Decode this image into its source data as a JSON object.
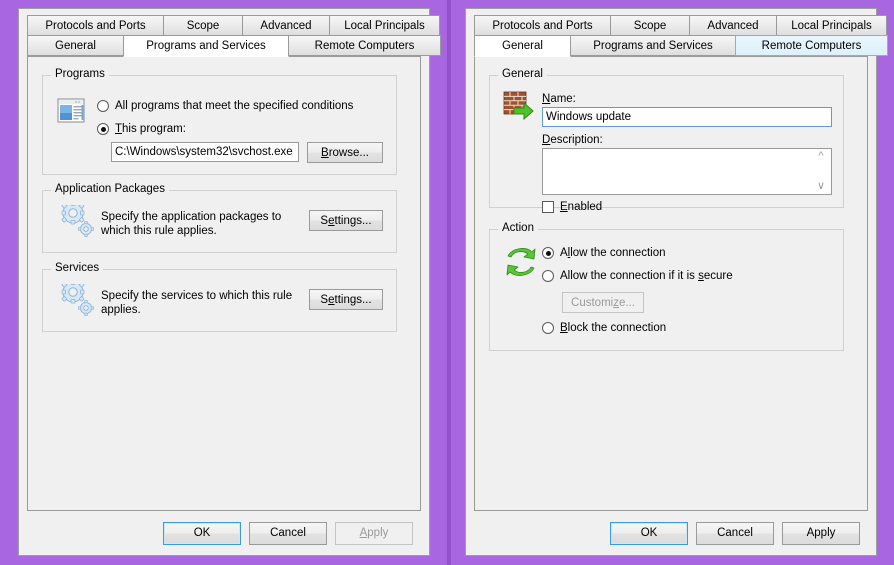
{
  "theme": {
    "desktop_bg": "#a866e0",
    "divider": "#9350cc",
    "dialog_bg": "#f0f0f0",
    "accent_focus": "#5a9fd4",
    "tab_hover": "#ddf1fb"
  },
  "left_dialog": {
    "tabs_row1": [
      {
        "label": "Protocols and Ports",
        "state": "normal"
      },
      {
        "label": "Scope",
        "state": "normal"
      },
      {
        "label": "Advanced",
        "state": "normal"
      },
      {
        "label": "Local Principals",
        "state": "normal"
      }
    ],
    "tabs_row2": [
      {
        "label": "General",
        "state": "normal"
      },
      {
        "label": "Programs and Services",
        "state": "active"
      },
      {
        "label": "Remote Computers",
        "state": "normal"
      }
    ],
    "programs_group": {
      "legend": "Programs",
      "icon": "application-window-icon",
      "radio_all": {
        "label": "All programs that meet the specified conditions",
        "checked": false
      },
      "radio_this": {
        "label": "This program:",
        "checked": true
      },
      "program_path": "C:\\Windows\\system32\\svchost.exe",
      "browse_button": "Browse..."
    },
    "app_packages_group": {
      "legend": "Application Packages",
      "icon": "gears-icon",
      "description": "Specify the application packages to which this rule applies.",
      "settings_button": "Settings..."
    },
    "services_group": {
      "legend": "Services",
      "icon": "gears-icon",
      "description": "Specify the services to which this rule applies.",
      "settings_button": "Settings..."
    },
    "buttons": {
      "ok": "OK",
      "cancel": "Cancel",
      "apply": "Apply",
      "apply_enabled": false
    }
  },
  "right_dialog": {
    "tabs_row1": [
      {
        "label": "Protocols and Ports",
        "state": "normal"
      },
      {
        "label": "Scope",
        "state": "normal"
      },
      {
        "label": "Advanced",
        "state": "normal"
      },
      {
        "label": "Local Principals",
        "state": "normal"
      }
    ],
    "tabs_row2": [
      {
        "label": "General",
        "state": "active"
      },
      {
        "label": "Programs and Services",
        "state": "normal"
      },
      {
        "label": "Remote Computers",
        "state": "hover"
      }
    ],
    "general_group": {
      "legend": "General",
      "icon": "firewall-inbound-rule-icon",
      "name_label": "Name:",
      "name_value": "Windows update",
      "description_label": "Description:",
      "description_value": "",
      "enabled_checkbox": {
        "label": "Enabled",
        "checked": false
      }
    },
    "action_group": {
      "legend": "Action",
      "icon": "green-cycle-arrows-icon",
      "options": [
        {
          "label": "Allow the connection",
          "checked": true
        },
        {
          "label": "Allow the connection if it is secure",
          "checked": false
        },
        {
          "label": "Block the connection",
          "checked": false
        }
      ],
      "customize_button": {
        "label": "Customize...",
        "enabled": false
      }
    },
    "buttons": {
      "ok": "OK",
      "cancel": "Cancel",
      "apply": "Apply",
      "apply_enabled": true
    }
  }
}
